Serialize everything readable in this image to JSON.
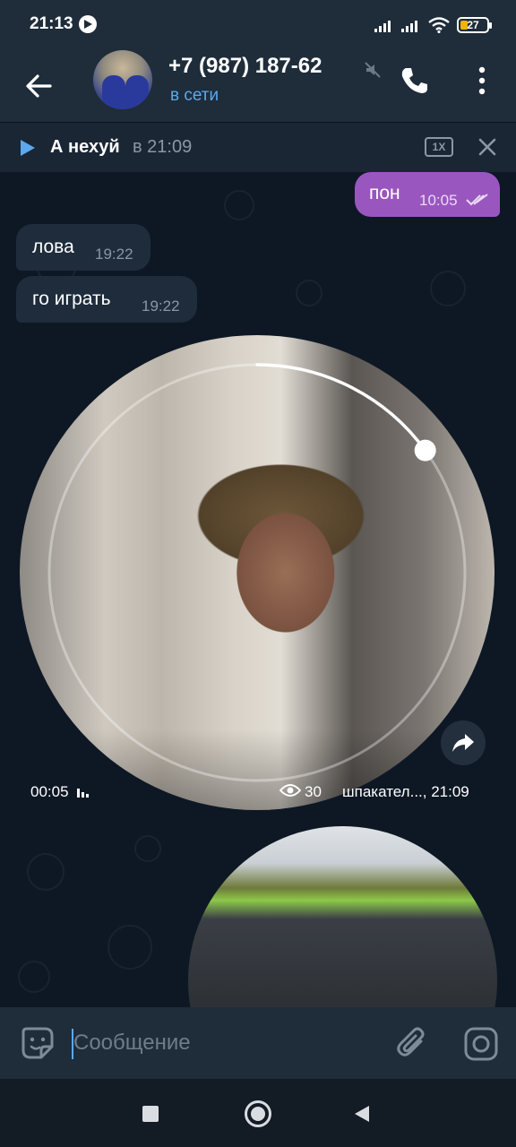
{
  "status_bar": {
    "time": "21:13",
    "battery": "27",
    "icons": [
      "play-circle-icon",
      "signal-icon",
      "signal-icon",
      "wifi-icon",
      "battery-icon"
    ]
  },
  "header": {
    "title": "+7 (987) 187-62",
    "status": "в сети",
    "icons": [
      "back-arrow-icon",
      "muted-icon",
      "phone-icon",
      "more-vert-icon"
    ]
  },
  "pinned_audio": {
    "name": "А нехуй",
    "time": "в 21:09",
    "speed": "1X"
  },
  "messages": [
    {
      "direction": "out",
      "text": "пон",
      "time": "10:05",
      "read": true
    },
    {
      "direction": "in",
      "text": "лова",
      "time": "19:22"
    },
    {
      "direction": "in",
      "text": "го играть",
      "time": "19:22"
    }
  ],
  "round_video": {
    "duration": "00:05",
    "views": "30",
    "meta": "шпакател..., 21:09",
    "progress": 0.15
  },
  "input": {
    "placeholder": "Сообщение"
  },
  "colors": {
    "accent": "#5aa9ee",
    "outgoing_bubble": "#9a56bf",
    "incoming_bubble": "#1e2c3b",
    "header_bg": "#1f2c3a",
    "chat_bg": "#0e1824"
  }
}
